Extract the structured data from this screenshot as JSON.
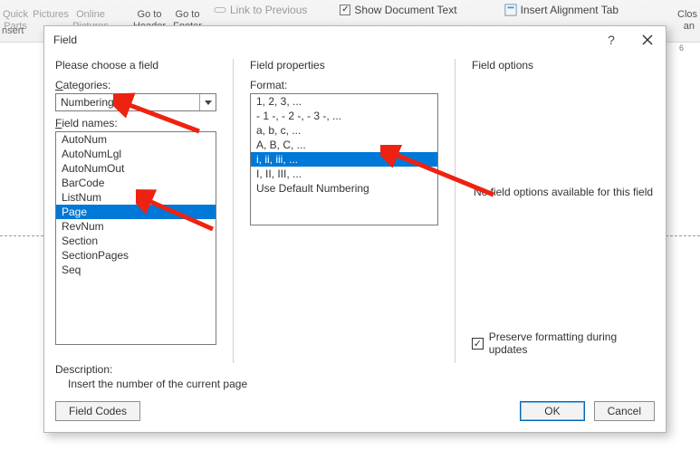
{
  "ribbon": {
    "quick_top": "Quick",
    "pictures": "Pictures",
    "online_top": "Online",
    "online_bottom": "Pictures",
    "parts_bottom": "Parts",
    "goto_top_1": "Go to",
    "goto_bottom_1": "Header",
    "goto_top_2": "Go to",
    "goto_bottom_2": "Footer",
    "link_to_previous": "Link to Previous",
    "show_doc_text": "Show Document Text",
    "insert_align_tab": "Insert Alignment Tab",
    "close_top": "Clos",
    "close_bottom": "an",
    "insert_group": "nsert"
  },
  "ruler": {
    "tick_6": "6"
  },
  "dialog": {
    "title": "Field",
    "choose_label": "Please choose a field",
    "categories_label_pre": "C",
    "categories_label_rest": "ategories:",
    "categories_value": "Numbering",
    "field_names_label_pre": "F",
    "field_names_label_rest": "ield names:",
    "field_names": [
      "AutoNum",
      "AutoNumLgl",
      "AutoNumOut",
      "BarCode",
      "ListNum",
      "Page",
      "RevNum",
      "Section",
      "SectionPages",
      "Seq"
    ],
    "field_names_selected": "Page",
    "properties_label": "Field properties",
    "format_label": "Format:",
    "formats": [
      "1, 2, 3, ...",
      "- 1 -, - 2 -, - 3 -, ...",
      "a, b, c, ...",
      "A, B, C, ...",
      "i, ii, iii, ...",
      "I, II, III, ...",
      "Use Default Numbering"
    ],
    "formats_selected": "i, ii, iii, ...",
    "options_label": "Field options",
    "no_options_text": "No field options available for this field",
    "preserve_label_pre": "Preser",
    "preserve_label_u": "v",
    "preserve_label_post": "e formatting during updates",
    "preserve_checked": "✓",
    "description_title": "Description:",
    "description_text": "Insert the number of the current page",
    "field_codes_btn": "Field Codes",
    "ok_btn": "OK",
    "cancel_btn": "Cancel"
  }
}
